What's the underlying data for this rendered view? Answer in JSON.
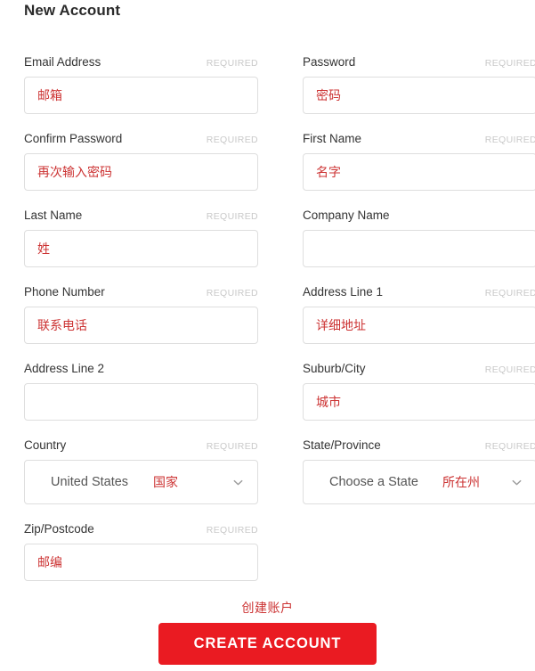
{
  "page_title": "New Account",
  "colors": {
    "accent_red": "#ea1b22",
    "annotation_red": "#cc3333",
    "label_gray": "#333333",
    "required_gray": "#c9c9c9",
    "border_gray": "#dedede"
  },
  "required_tag_text": "REQUIRED",
  "fields": [
    {
      "id": "email-address",
      "label": "Email Address",
      "required": true,
      "required_label": "REQUIRED",
      "value": "邮箱",
      "type": "text"
    },
    {
      "id": "password",
      "label": "Password",
      "required": true,
      "required_label": "REQUIRED",
      "value": "密码",
      "type": "text"
    },
    {
      "id": "confirm-password",
      "label": "Confirm Password",
      "required": true,
      "required_label": "REQUIRED",
      "value": "再次输入密码",
      "type": "text"
    },
    {
      "id": "first-name",
      "label": "First Name",
      "required": true,
      "required_label": "REQUIRED",
      "value": "名字",
      "type": "text"
    },
    {
      "id": "last-name",
      "label": "Last Name",
      "required": true,
      "required_label": "REQUIRED",
      "value": "姓",
      "type": "text"
    },
    {
      "id": "company-name",
      "label": "Company Name",
      "required": false,
      "required_label": "",
      "value": "",
      "type": "text"
    },
    {
      "id": "phone-number",
      "label": "Phone Number",
      "required": true,
      "required_label": "REQUIRED",
      "value": "联系电话",
      "type": "text"
    },
    {
      "id": "address-line-1",
      "label": "Address Line 1",
      "required": true,
      "required_label": "REQUIRED",
      "value": "详细地址",
      "type": "text"
    },
    {
      "id": "address-line-2",
      "label": "Address Line 2",
      "required": false,
      "required_label": "",
      "value": "",
      "type": "text"
    },
    {
      "id": "suburb-city",
      "label": "Suburb/City",
      "required": true,
      "required_label": "REQUIRED",
      "value": "城市",
      "type": "text"
    },
    {
      "id": "country",
      "label": "Country",
      "required": true,
      "required_label": "REQUIRED",
      "value": "United States",
      "note": "国家",
      "type": "select",
      "icon": "chevron-down-icon"
    },
    {
      "id": "state-province",
      "label": "State/Province",
      "required": true,
      "required_label": "REQUIRED",
      "value": "Choose a State",
      "note": "所在州",
      "type": "select",
      "icon": "chevron-down-icon"
    },
    {
      "id": "zip-postcode",
      "label": "Zip/Postcode",
      "required": true,
      "required_label": "REQUIRED",
      "value": "邮编",
      "type": "text"
    }
  ],
  "footer": {
    "submit_note": "创建账户",
    "submit_label": "CREATE ACCOUNT"
  }
}
